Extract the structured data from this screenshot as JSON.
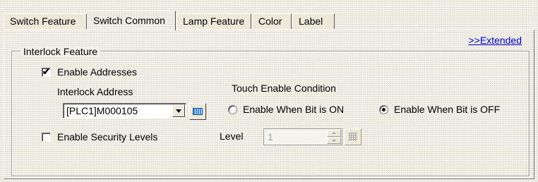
{
  "tabs": [
    {
      "label": "Switch Feature",
      "active": false
    },
    {
      "label": "Switch Common",
      "active": true
    },
    {
      "label": "Lamp Feature",
      "active": false
    },
    {
      "label": "Color",
      "active": false
    },
    {
      "label": "Label",
      "active": false
    }
  ],
  "extended_link": ">>Extended",
  "interlock": {
    "group_title": "Interlock Feature",
    "enable_addresses": {
      "label": "Enable Addresses",
      "checked": true
    },
    "address_label": "Interlock Address",
    "address_value": "[PLC1]M000105",
    "address_button_icon": "keyboard-icon",
    "touch_condition_label": "Touch Enable Condition",
    "radio_on": {
      "label": "Enable When Bit is ON",
      "selected": false
    },
    "radio_off": {
      "label": "Enable When Bit is OFF",
      "selected": true
    },
    "enable_security": {
      "label": "Enable Security Levels",
      "checked": false
    },
    "level_label": "Level",
    "level_value": "1",
    "level_enabled": false,
    "level_button_icon": "keypad-icon"
  }
}
